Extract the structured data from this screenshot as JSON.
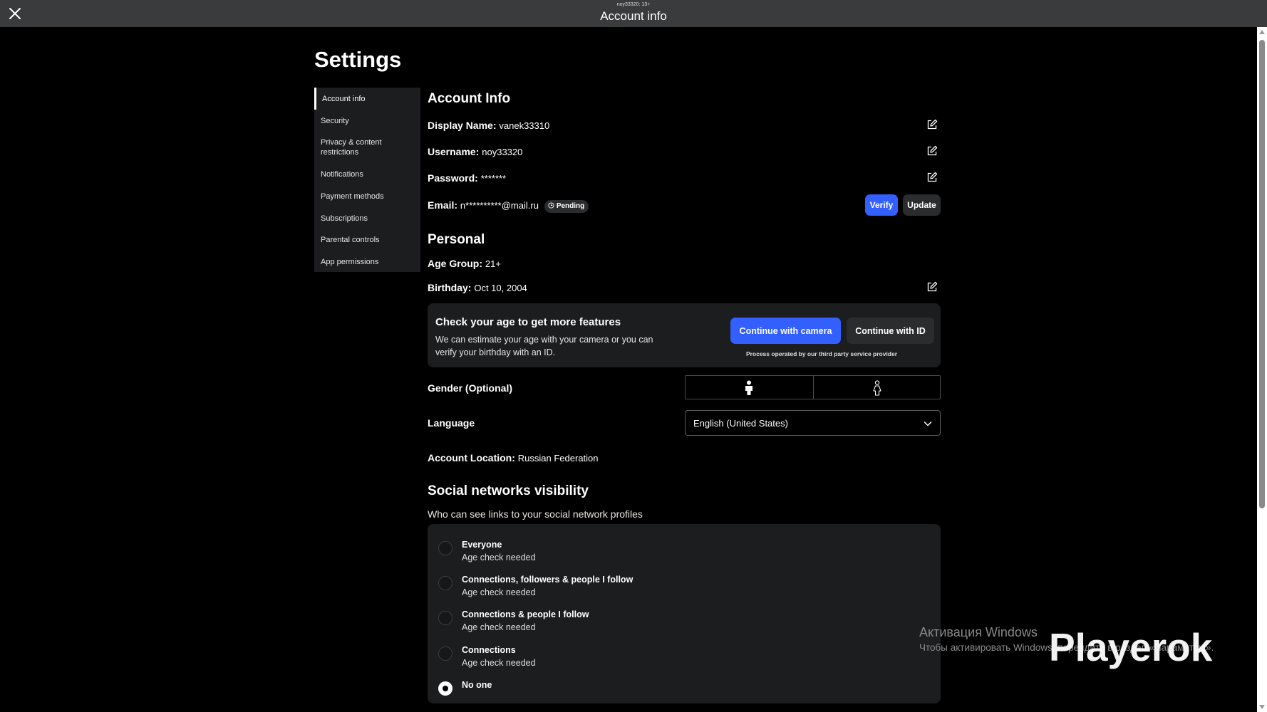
{
  "window": {
    "subtitle": "noy33320: 13+",
    "title": "Account info"
  },
  "page_title": "Settings",
  "sidebar": {
    "items": [
      {
        "label": "Account info",
        "active": true
      },
      {
        "label": "Security"
      },
      {
        "label": "Privacy & content restrictions"
      },
      {
        "label": "Notifications"
      },
      {
        "label": "Payment methods"
      },
      {
        "label": "Subscriptions"
      },
      {
        "label": "Parental controls"
      },
      {
        "label": "App permissions"
      }
    ]
  },
  "account_info": {
    "heading": "Account Info",
    "display_name_label": "Display Name:",
    "display_name": "vanek33310",
    "username_label": "Username:",
    "username": "noy33320",
    "password_label": "Password:",
    "password": "*******",
    "email_label": "Email:",
    "email": "n**********@mail.ru",
    "email_status": "Pending",
    "verify_label": "Verify",
    "update_label": "Update"
  },
  "personal": {
    "heading": "Personal",
    "age_group_label": "Age Group:",
    "age_group": "21+",
    "birthday_label": "Birthday:",
    "birthday": "Oct 10, 2004",
    "age_check": {
      "title": "Check your age to get more features",
      "description": "We can estimate your age with your camera or you can verify your birthday with an ID.",
      "camera_button": "Continue with camera",
      "id_button": "Continue with ID",
      "note": "Process operated by our third party service provider"
    },
    "gender_label": "Gender (Optional)",
    "gender_options": [
      "male-icon",
      "female-icon"
    ],
    "language_label": "Language",
    "language_value": "English (United States)",
    "location_label": "Account Location:",
    "location_value": "Russian Federation"
  },
  "social": {
    "heading": "Social networks visibility",
    "subheading": "Who can see links to your social network profiles",
    "options": [
      {
        "label": "Everyone",
        "sub": "Age check needed",
        "selected": false
      },
      {
        "label": "Connections, followers & people I follow",
        "sub": "Age check needed",
        "selected": false
      },
      {
        "label": "Connections & people I follow",
        "sub": "Age check needed",
        "selected": false
      },
      {
        "label": "Connections",
        "sub": "Age check needed",
        "selected": false
      },
      {
        "label": "No one",
        "sub": "",
        "selected": true
      }
    ]
  },
  "overlay": {
    "activation_title": "Активация Windows",
    "activation_sub": "Чтобы активировать Windows, перейдите в раздел «Параметры».",
    "brand": "Playerok"
  },
  "colors": {
    "background": "#000000",
    "topbar": "#393b3d",
    "card": "#1c1d1f",
    "primary_button": "#335fff",
    "secondary_button": "#2b2c2e"
  }
}
